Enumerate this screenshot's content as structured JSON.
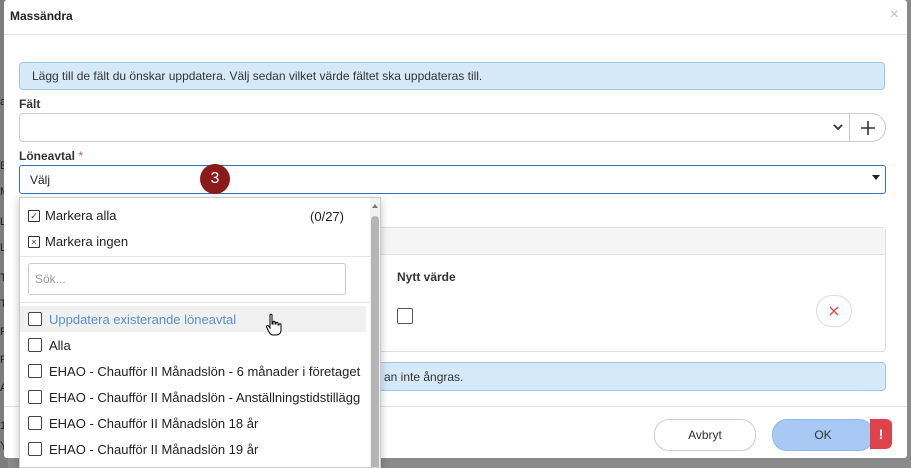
{
  "background": {
    "side_letters": [
      "a",
      "B",
      "M",
      "L",
      "L",
      "T",
      "T",
      "R",
      "R",
      "A",
      "1",
      "Y"
    ]
  },
  "modal": {
    "title": "Massändra",
    "close_icon": "close-icon",
    "info_text": "Lägg till de fält du önskar uppdatera. Välj sedan vilket värde fältet ska uppdateras till.",
    "falt_label": "Fält",
    "falt_value": "",
    "add_icon": "plus-icon",
    "loneavtal_label": "Löneavtal",
    "required_mark": "*",
    "loneavtal_value": "Välj",
    "step_badge": "3",
    "nytt_varde_label": "Nytt värde",
    "warning_text_visible": "an inte ångras.",
    "footer": {
      "cancel_label": "Avbryt",
      "ok_label": "OK",
      "alert_symbol": "!"
    }
  },
  "dropdown": {
    "select_all_label": "Markera alla",
    "select_none_label": "Markera ingen",
    "count": "(0/27)",
    "search_placeholder": "Sök...",
    "options": [
      "Uppdatera existerande löneavtal",
      "Alla",
      "EHAO - Chaufför II Månadslön - 6 månader i företaget",
      "EHAO - Chaufför II Månadslön - Anställningstidstillägg",
      "EHAO - Chaufför II Månadslön 18 år",
      "EHAO - Chaufför II Månadslön 19 år"
    ]
  },
  "colors": {
    "accent": "#2f72c4",
    "info_bg": "#d6e9f8",
    "badge": "#8b1a1a",
    "danger": "#e0424a",
    "ok_button": "#a9c9f5",
    "hover_text": "#5a8fd0"
  }
}
